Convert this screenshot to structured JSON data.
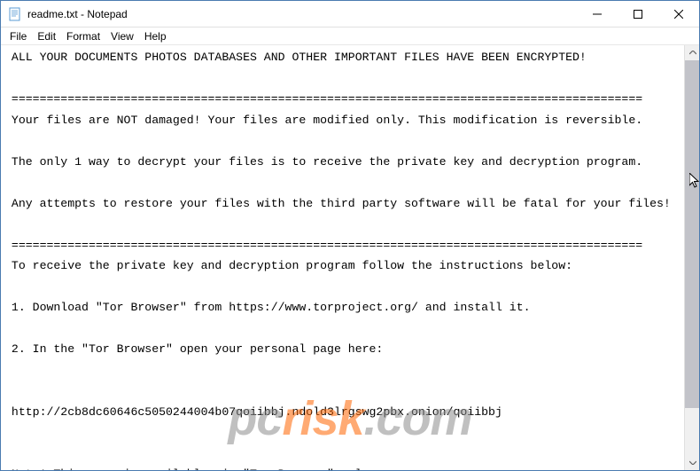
{
  "window": {
    "title": "readme.txt - Notepad"
  },
  "menu": {
    "file": "File",
    "edit": "Edit",
    "format": "Format",
    "view": "View",
    "help": "Help"
  },
  "controls": {
    "minimize": "—",
    "maximize": "☐",
    "close": "✕"
  },
  "content": {
    "text": " ALL YOUR DOCUMENTS PHOTOS DATABASES AND OTHER IMPORTANT FILES HAVE BEEN ENCRYPTED!\n\n ==========================================================================================\n Your files are NOT damaged! Your files are modified only. This modification is reversible.\n\n The only 1 way to decrypt your files is to receive the private key and decryption program.\n\n Any attempts to restore your files with the third party software will be fatal for your files!\n\n ==========================================================================================\n To receive the private key and decryption program follow the instructions below:\n\n 1. Download \"Tor Browser\" from https://www.torproject.org/ and install it.\n\n 2. In the \"Tor Browser\" open your personal page here:\n\n\n http://2cb8dc60646c5050244004b07qoiibbj.ndold3lrgswg2pbx.onion/qoiibbj\n\n\n Note! This page is available via \"Tor Browser\" only.\n\n ==========================================================================================\n Also you can use temporary addresses on your personal page without using \"Tor Browser\":\n\n\n http://2cb8dc60646c5050244004b07qoiibbj.badcare.top/qoiibbj\n\n http://2cb8dc60646c5050244004b07qoiibbj.hillfly.win/qoiibbj"
  },
  "watermark": {
    "p1": "pc",
    "p2": "risk",
    "p3": ".com"
  }
}
